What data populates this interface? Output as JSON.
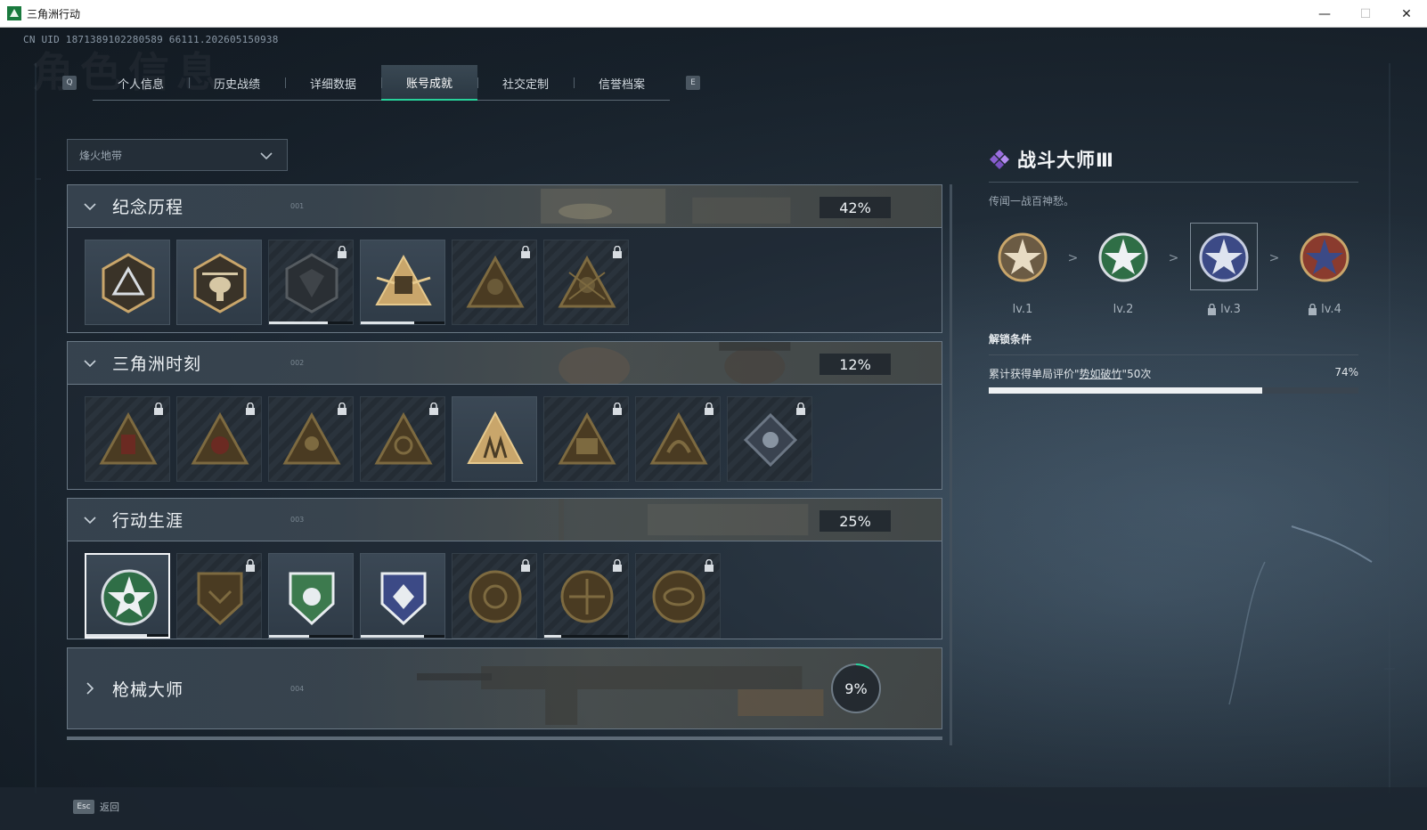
{
  "window": {
    "title": "三角洲行动",
    "minimize": "—",
    "maximize": "☐",
    "close": "✕"
  },
  "uid": "CN UID 1871389102280589 66111.202605150938",
  "bg_title": "角色信息",
  "tabs": {
    "left_key": "Q",
    "right_key": "E",
    "items": [
      "个人信息",
      "历史战绩",
      "详细数据",
      "账号成就",
      "社交定制",
      "信誉档案"
    ],
    "active": "账号成就"
  },
  "filter": {
    "selected": "烽火地带"
  },
  "categories": [
    {
      "name": "纪念历程",
      "index": "001",
      "percent": "42%",
      "expanded": true
    },
    {
      "name": "三角洲时刻",
      "index": "002",
      "percent": "12%",
      "expanded": true
    },
    {
      "name": "行动生涯",
      "index": "003",
      "percent": "25%",
      "expanded": true
    },
    {
      "name": "枪械大师",
      "index": "004",
      "percent": "9%",
      "expanded": false,
      "progress": 0.09
    }
  ],
  "detail": {
    "title": "战斗大师Ⅲ",
    "description": "传闻一战百神愁。",
    "levels": [
      {
        "label": "lv.1",
        "locked": false
      },
      {
        "label": "lv.2",
        "locked": false
      },
      {
        "label": "lv.3",
        "locked": true
      },
      {
        "label": "lv.4",
        "locked": true
      }
    ],
    "level_arrow": ">",
    "unlock_heading": "解锁条件",
    "condition": {
      "prefix": "累计获得单局评价\"",
      "highlight": "势如破竹",
      "suffix": "\"50次",
      "percent": "74%",
      "progress": 0.74
    }
  },
  "footer": {
    "esc_key": "Esc",
    "back_label": "返回"
  },
  "colors": {
    "accent": "#27d19a",
    "gold": "#c9a66b",
    "green_badge": "#3d7a4e",
    "blue_badge": "#3c4a86",
    "red_badge": "#8a3b2e"
  }
}
